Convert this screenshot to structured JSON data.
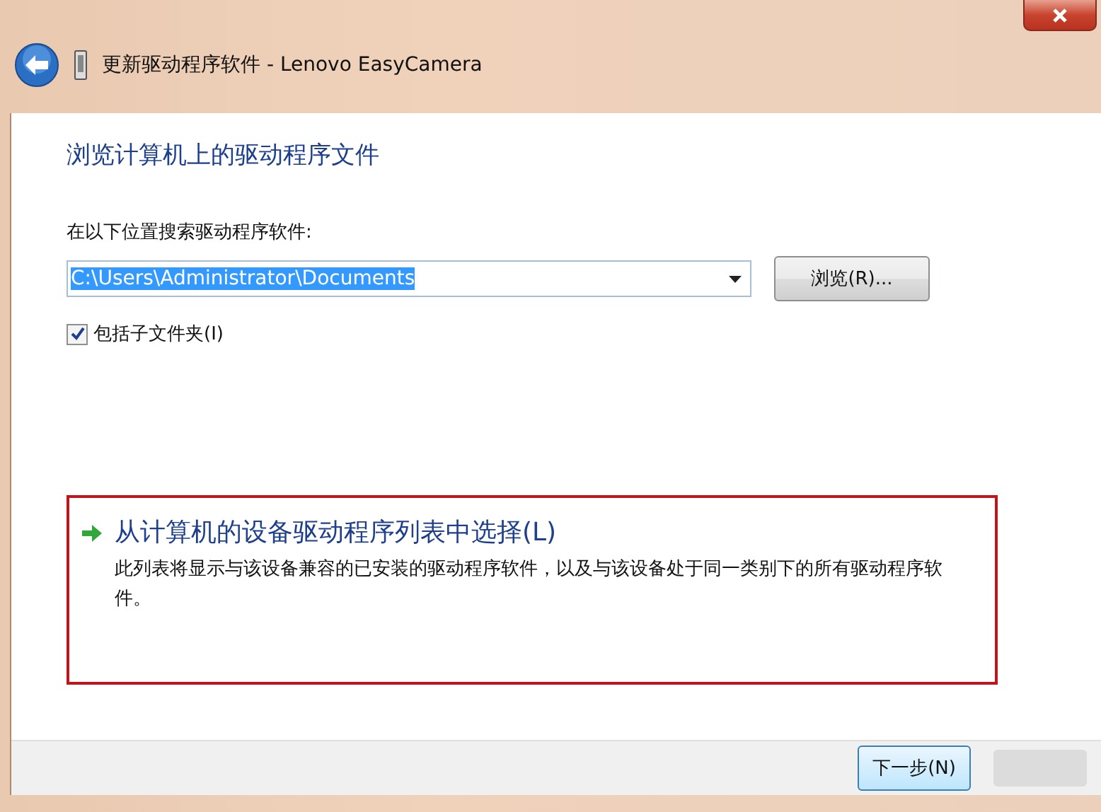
{
  "window": {
    "title": "更新驱动程序软件 - Lenovo EasyCamera"
  },
  "heading": "浏览计算机上的驱动程序文件",
  "search_label": "在以下位置搜索驱动程序软件:",
  "path_field": {
    "value": "C:\\Users\\Administrator\\Documents",
    "selected": true
  },
  "browse_button": "浏览(R)...",
  "include_subfolders": {
    "label": "包括子文件夹(I)",
    "checked": true
  },
  "option": {
    "title": "从计算机的设备驱动程序列表中选择(L)",
    "description": "此列表将显示与该设备兼容的已安装的驱动程序软件，以及与该设备处于同一类别下的所有驱动程序软件。",
    "highlighted": true
  },
  "buttons": [
    {
      "label": "下一步(N)",
      "kind": "default"
    },
    {
      "kind": "blurred"
    }
  ]
}
